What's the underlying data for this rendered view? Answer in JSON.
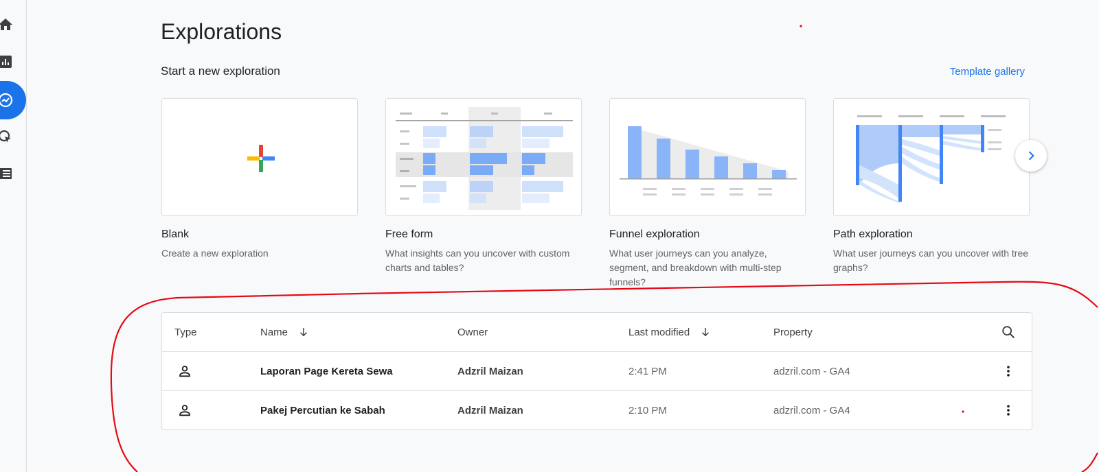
{
  "nav": {
    "items": [
      {
        "icon": "home-icon"
      },
      {
        "icon": "bar-chart-icon"
      },
      {
        "icon": "explore-icon",
        "active": true
      },
      {
        "icon": "cursor-click-icon"
      },
      {
        "icon": "list-icon"
      }
    ]
  },
  "header": {
    "title": "Explorations",
    "subtitle": "Start a new exploration",
    "gallery_link": "Template gallery"
  },
  "templates": [
    {
      "title": "Blank",
      "description": "Create a new exploration"
    },
    {
      "title": "Free form",
      "description": "What insights can you uncover with custom charts and tables?"
    },
    {
      "title": "Funnel exploration",
      "description": "What user journeys can you analyze, segment, and breakdown with multi-step funnels?"
    },
    {
      "title": "Path exploration",
      "description": "What user journeys can you uncover with tree graphs?"
    }
  ],
  "table": {
    "columns": [
      "Type",
      "Name",
      "Owner",
      "Last modified",
      "Property"
    ],
    "rows": [
      {
        "type_icon": "person-icon",
        "name": "Laporan Page Kereta Sewa",
        "owner": "Adzril Maizan",
        "last_modified": "2:41 PM",
        "property": "adzril.com - GA4"
      },
      {
        "type_icon": "person-icon",
        "name": "Pakej Percutian ke Sabah",
        "owner": "Adzril Maizan",
        "last_modified": "2:10 PM",
        "property": "adzril.com - GA4"
      }
    ]
  },
  "colors": {
    "accent": "#1a73e8",
    "annotation": "#e50914"
  }
}
